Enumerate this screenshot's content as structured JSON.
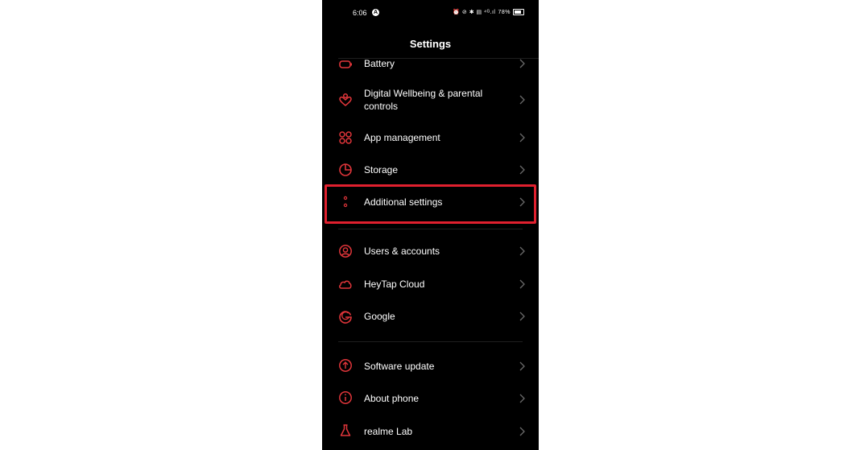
{
  "status_bar": {
    "time": "6:06",
    "a_badge": "A",
    "indicators": "⏰ ⊘ ✱ ▤ ⁴ᴳ.ıl",
    "battery_percent": "78%"
  },
  "header": {
    "title": "Settings"
  },
  "items": [
    {
      "label": "Battery",
      "icon": "battery-icon"
    },
    {
      "label": "Digital Wellbeing & parental controls",
      "icon": "wellbeing-icon"
    },
    {
      "label": "App management",
      "icon": "apps-grid-icon"
    },
    {
      "label": "Storage",
      "icon": "storage-pie-icon"
    },
    {
      "label": "Additional settings",
      "icon": "more-dots-icon",
      "highlighted": true
    },
    {
      "label": "Users & accounts",
      "icon": "user-icon"
    },
    {
      "label": "HeyTap Cloud",
      "icon": "cloud-icon"
    },
    {
      "label": "Google",
      "icon": "google-icon"
    },
    {
      "label": "Software update",
      "icon": "update-arrow-icon"
    },
    {
      "label": "About phone",
      "icon": "info-icon"
    },
    {
      "label": "realme Lab",
      "icon": "flask-icon"
    }
  ],
  "colors": {
    "accent": "#e0202e",
    "icon": "#e0353a",
    "background": "#000000",
    "text": "#ffffff",
    "chevron": "#6a6a6a"
  }
}
